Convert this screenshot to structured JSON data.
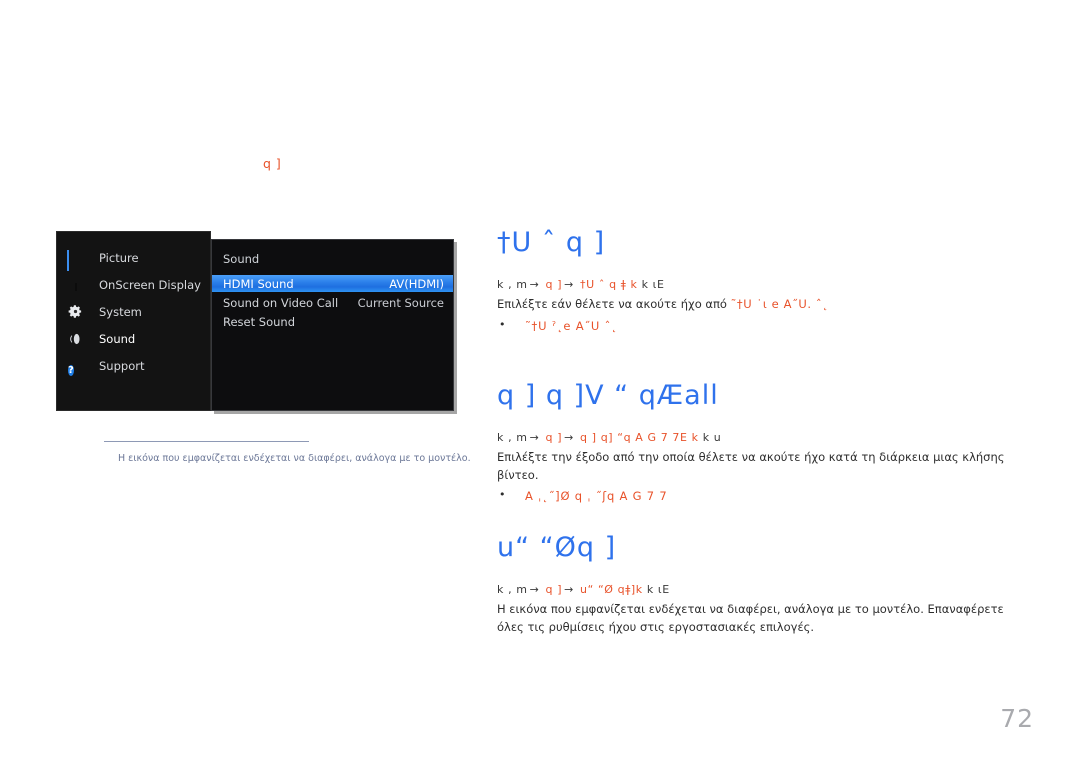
{
  "page": {
    "number": "72",
    "top_label": "q ]"
  },
  "osd": {
    "sidebar": {
      "items": [
        {
          "label": "Picture",
          "icon": "picture-icon",
          "selected": false
        },
        {
          "label": "OnScreen Display",
          "icon": "onscreen-display-icon",
          "selected": false
        },
        {
          "label": "System",
          "icon": "gear-icon",
          "selected": false
        },
        {
          "label": "Sound",
          "icon": "speaker-icon",
          "selected": true
        },
        {
          "label": "Support",
          "icon": "question-mark-icon",
          "selected": false
        }
      ]
    },
    "panel": {
      "title": "Sound",
      "rows": [
        {
          "label": "HDMI Sound",
          "value": "AV(HDMI)",
          "selected": true
        },
        {
          "label": "Sound on Video Call",
          "value": "Current Source",
          "selected": false
        },
        {
          "label": "Reset Sound",
          "value": "",
          "selected": false
        }
      ]
    },
    "caption": "Η εικόνα που εμφανίζεται ενδέχεται να διαφέρει, ανάλογα με το μοντέλο."
  },
  "sections": [
    {
      "heading": "†U ˆ q ]",
      "breadcrumb": {
        "prefix": "k , m",
        "step1": "q ]",
        "step2": "†U ˆ  q ǂ k",
        "suffix": "k ɩE"
      },
      "body_prefix": "Επιλέξτε εάν θέλετε να ακούτε ήχο από ",
      "body_ui": "˜†U  ˙ɩ e A˝U. ˆ˛",
      "bullets": [
        "˜†U  ˀ˛e A˝U  ˆ˛"
      ]
    },
    {
      "heading": "q ] q ]V  “ qÆall",
      "breadcrumb": {
        "prefix": "k , m",
        "step1": "q ]",
        "step2": "q ]   q]     “q  A G 7 7Ε k",
        "suffix": "k u"
      },
      "body_prefix": "Επιλέξτε την έξοδο από την οποία θέλετε να ακούτε ήχο κατά τη διάρκεια μιας κλήσης βίντεο.",
      "body_ui": "",
      "bullets": [
        "A ˌ˛˝]Ø   q ˌ  ˝ʃq  A G 7 7"
      ]
    },
    {
      "heading": "u“ “Øq ]",
      "breadcrumb": {
        "prefix": "k , m",
        "step1": "q ]",
        "step2": "u“ “Ø   qǂ]k",
        "suffix": "k ɩE"
      },
      "body_prefix": "Η εικόνα που εμφανίζεται ενδέχεται να διαφέρει, ανάλογα με το μοντέλο. Επαναφέρετε όλες τις ρυθμίσεις ήχου στις εργοστασιακές επιλογές.",
      "body_ui": "",
      "bullets": []
    }
  ],
  "colors": {
    "heading_blue": "#2f72ec",
    "ui_orange": "#e8522a",
    "osd_highlight": "#2a7ee9",
    "caption_gray": "#6b7797",
    "page_number_gray": "#a9aaae"
  }
}
